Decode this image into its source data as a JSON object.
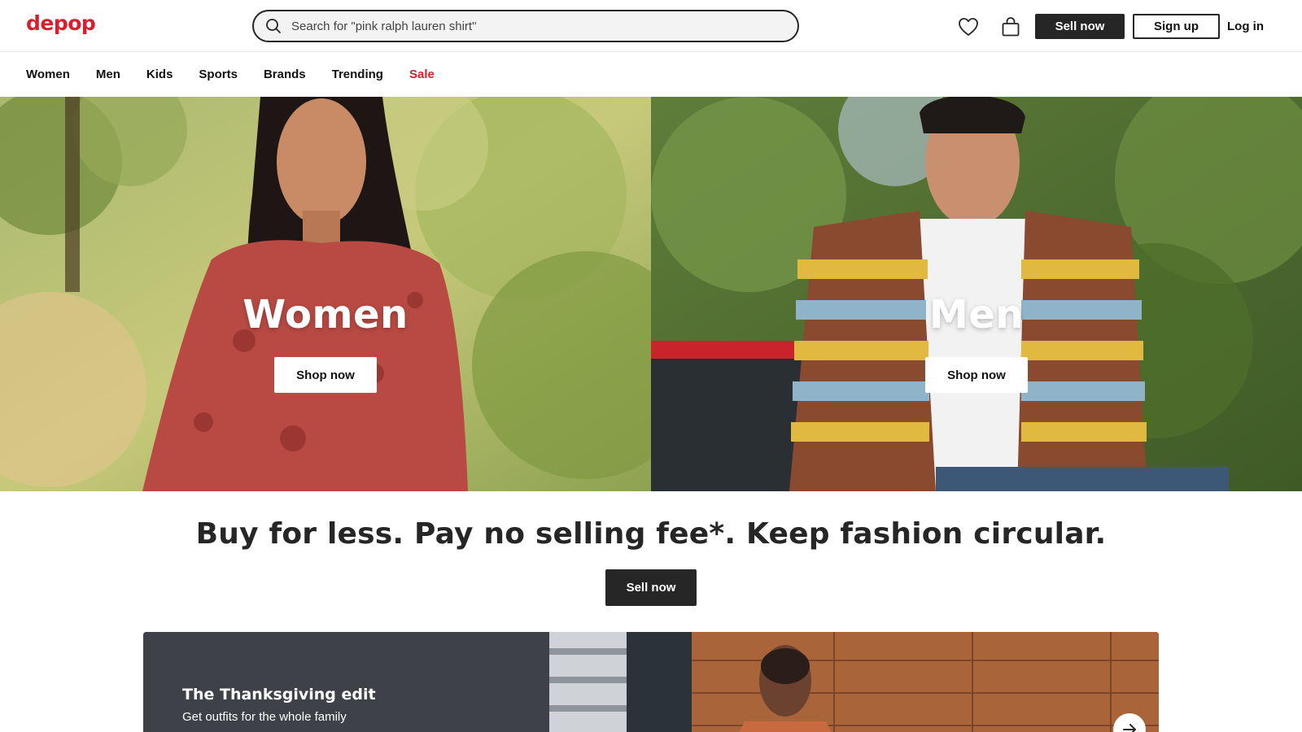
{
  "brand": {
    "logo_text": "depop",
    "accent_color": "#d6202e"
  },
  "search": {
    "placeholder": "Search for \"pink ralph lauren shirt\"",
    "icon": "search-icon"
  },
  "header": {
    "icons": [
      "heart-icon",
      "bag-icon"
    ],
    "sell_label": "Sell now",
    "signup_label": "Sign up",
    "login_label": "Log in"
  },
  "nav": {
    "items": [
      {
        "label": "Women"
      },
      {
        "label": "Men"
      },
      {
        "label": "Kids"
      },
      {
        "label": "Sports"
      },
      {
        "label": "Brands"
      },
      {
        "label": "Trending"
      },
      {
        "label": "Sale",
        "color": "#d6202e"
      }
    ]
  },
  "hero": {
    "left": {
      "title": "Women",
      "button": "Shop now"
    },
    "right": {
      "title": "Men",
      "button": "Shop now"
    }
  },
  "tagline": {
    "text": "Buy for less. Pay no selling fee*. Keep fashion circular.",
    "button": "Sell now"
  },
  "promo": {
    "title": "The Thanksgiving edit",
    "subtitle": "Get outfits for the whole family",
    "icon": "arrow-right-icon"
  }
}
